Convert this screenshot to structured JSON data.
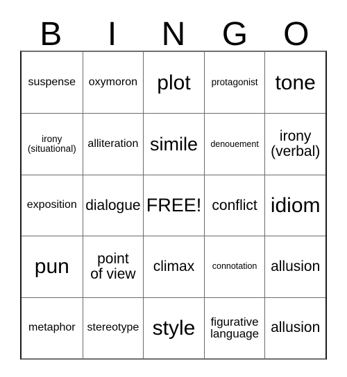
{
  "card": {
    "header_letters": [
      "B",
      "I",
      "N",
      "G",
      "O"
    ],
    "rows": [
      [
        {
          "label": "suspense",
          "size": "sm"
        },
        {
          "label": "oxymoron",
          "size": "sm"
        },
        {
          "label": "plot",
          "size": "xl"
        },
        {
          "label": "protagonist",
          "size": "xs"
        },
        {
          "label": "tone",
          "size": "xl"
        }
      ],
      [
        {
          "label": "irony\n(situational)",
          "size": "two-xs"
        },
        {
          "label": "alliteration",
          "size": "sm"
        },
        {
          "label": "simile",
          "size": "lg"
        },
        {
          "label": "denouement",
          "size": "xxs"
        },
        {
          "label": "irony\n(verbal)",
          "size": "two"
        }
      ],
      [
        {
          "label": "exposition",
          "size": "sm"
        },
        {
          "label": "dialogue",
          "size": "md"
        },
        {
          "label": "FREE!",
          "size": "lg"
        },
        {
          "label": "conflict",
          "size": "md"
        },
        {
          "label": "idiom",
          "size": "xl"
        }
      ],
      [
        {
          "label": "pun",
          "size": "xl"
        },
        {
          "label": "point\nof view",
          "size": "two"
        },
        {
          "label": "climax",
          "size": "md"
        },
        {
          "label": "connotation",
          "size": "xxs"
        },
        {
          "label": "allusion",
          "size": "md"
        }
      ],
      [
        {
          "label": "metaphor",
          "size": "sm"
        },
        {
          "label": "stereotype",
          "size": "sm"
        },
        {
          "label": "style",
          "size": "xl"
        },
        {
          "label": "figurative\nlanguage",
          "size": "two-sm"
        },
        {
          "label": "allusion",
          "size": "md"
        }
      ]
    ],
    "free_space": "FREE!",
    "colors": {
      "background": "#ffffff",
      "text": "#000000",
      "grid_line": "#6b6b6b",
      "border": "#1a1a1a"
    }
  }
}
